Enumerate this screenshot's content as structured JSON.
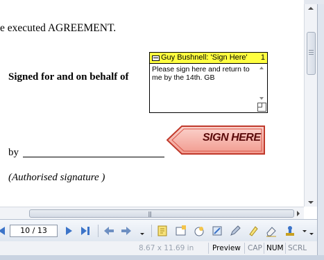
{
  "document": {
    "agreement_text": "e executed AGREEMENT.",
    "signed_for": "Signed for and on behalf of",
    "by": "by",
    "authorised": "(Authorised signature )"
  },
  "note": {
    "author": "Guy Bushnell: 'Sign Here'",
    "page": "1",
    "body": "Please sign here and return to me by the 14th. GB"
  },
  "stamp": {
    "label": "SIGN HERE",
    "fill": "#f4a49a",
    "border": "#c0392b"
  },
  "navigation": {
    "page_indicator": "10 / 13"
  },
  "toolbar_icons": [
    "first-page-icon",
    "previous-page-icon",
    "next-page-icon",
    "last-page-icon",
    "back-icon",
    "forward-icon",
    "note-icon",
    "text-box-icon",
    "stamp-icon",
    "link-icon",
    "pencil-icon",
    "highlighter-icon",
    "eraser-icon",
    "signature-stamp-icon"
  ],
  "statusbar": {
    "page_size": "8.67 x 11.69 in",
    "mode": "Preview",
    "cap": "CAP",
    "num": "NUM",
    "scrl": "SCRL"
  }
}
